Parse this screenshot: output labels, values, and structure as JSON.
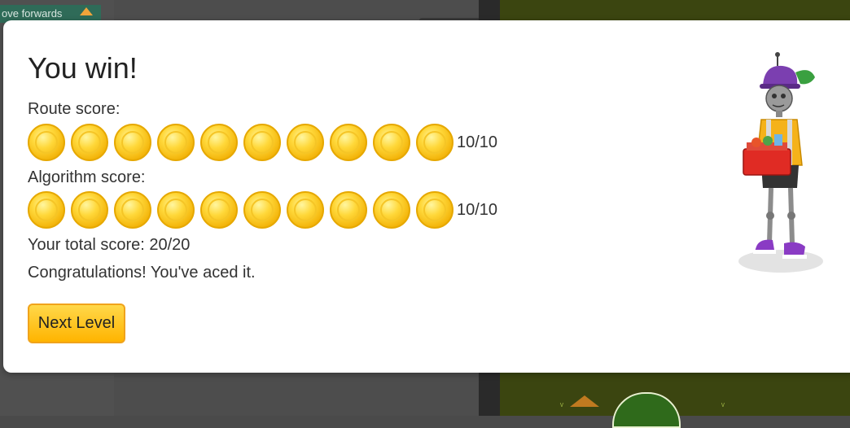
{
  "background": {
    "block_label": "ove forwards"
  },
  "modal": {
    "title": "You win!",
    "route_label": "Route score:",
    "route_coins": 10,
    "route_score": "10/10",
    "algorithm_label": "Algorithm score:",
    "algorithm_coins": 10,
    "algorithm_score": "10/10",
    "total": "Your total score: 20/20",
    "message": "Congratulations! You've aced it.",
    "next_button": "Next Level"
  },
  "colors": {
    "coin": "#f5c526",
    "button": "#ffc21a",
    "grass": "#3b4510"
  }
}
